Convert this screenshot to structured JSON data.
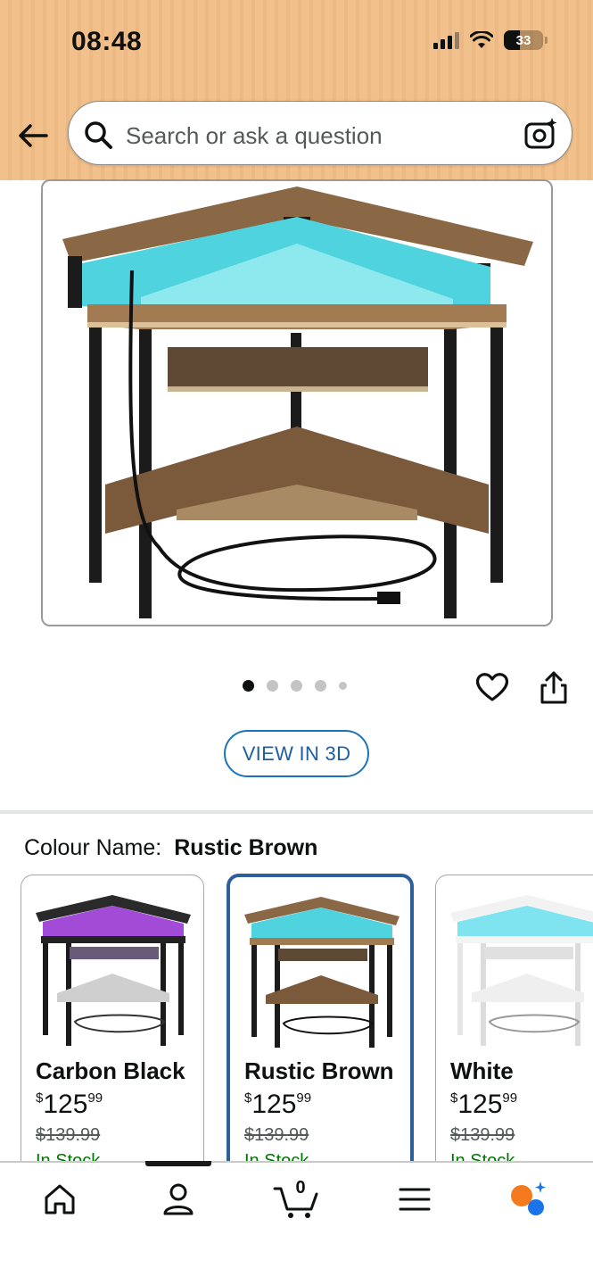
{
  "status_bar": {
    "time": "08:48",
    "battery": "33"
  },
  "search": {
    "placeholder": "Search or ask a question"
  },
  "gallery": {
    "image_count": 5,
    "active_index": 0,
    "view_3d_label": "VIEW IN 3D"
  },
  "colour": {
    "label": "Colour Name:",
    "selected": "Rustic Brown",
    "options": [
      {
        "name": "Carbon Black",
        "price_whole": "125",
        "price_fraction": "99",
        "currency": "$",
        "list_price": "$139.99",
        "stock": "In Stock"
      },
      {
        "name": "Rustic Brown",
        "price_whole": "125",
        "price_fraction": "99",
        "currency": "$",
        "list_price": "$139.99",
        "stock": "In Stock"
      },
      {
        "name": "White",
        "price_whole": "125",
        "price_fraction": "99",
        "currency": "$",
        "list_price": "$139.99",
        "stock": "In Stock"
      }
    ]
  },
  "nav": {
    "cart_count": "0",
    "active_tab": "profile"
  },
  "colors": {
    "accent_blue": "#1d73b8",
    "selected_border": "#2f5f9b",
    "stock_green": "#007600",
    "header_bg": "#f2c08b"
  }
}
